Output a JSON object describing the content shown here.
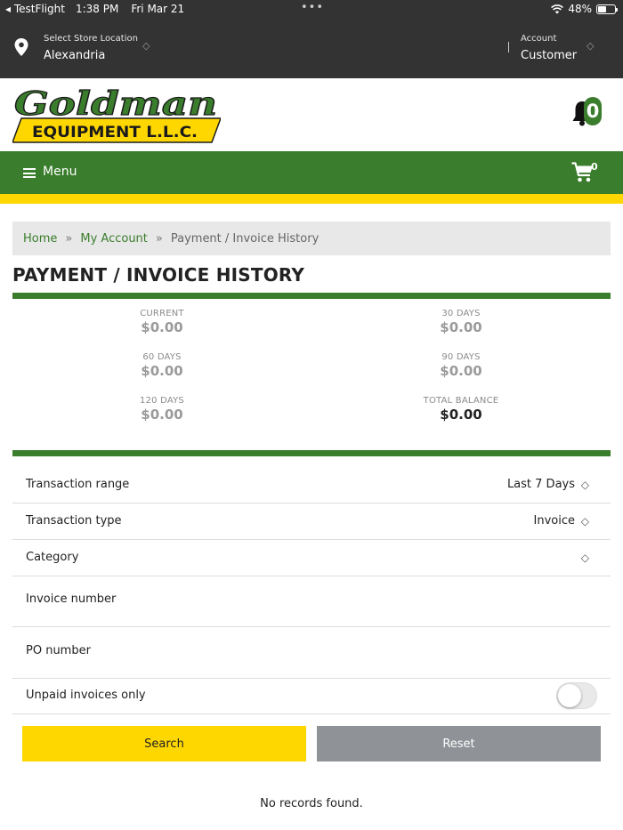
{
  "status_bar": {
    "back_app": "TestFlight",
    "time": "1:38 PM",
    "date": "Fri Mar 21",
    "dots": "•••",
    "battery": "48%",
    "battery_level": 0.48
  },
  "header": {
    "store_location_label": "Select Store Location",
    "store_location_value": "Alexandria",
    "account_label": "Account",
    "account_value": "Customer"
  },
  "brand": {
    "logo_line1": "Goldman",
    "logo_line2": "EQUIPMENT L.L.C.",
    "notification_count": "0"
  },
  "nav": {
    "menu_label": "Menu",
    "cart_count": "0"
  },
  "breadcrumb": {
    "home": "Home",
    "sep": "»",
    "my_account": "My Account",
    "current": "Payment / Invoice History"
  },
  "page": {
    "title": "PAYMENT / INVOICE HISTORY"
  },
  "summary": {
    "current_label": "CURRENT",
    "current_value": "$0.00",
    "d30_label": "30 DAYS",
    "d30_value": "$0.00",
    "d60_label": "60 DAYS",
    "d60_value": "$0.00",
    "d90_label": "90 DAYS",
    "d90_value": "$0.00",
    "d120_label": "120 DAYS",
    "d120_value": "$0.00",
    "total_label": "TOTAL BALANCE",
    "total_value": "$0.00"
  },
  "filters": {
    "transaction_range_label": "Transaction range",
    "transaction_range_value": "Last 7 Days",
    "transaction_type_label": "Transaction type",
    "transaction_type_value": "Invoice",
    "category_label": "Category",
    "category_value": "",
    "invoice_number_label": "Invoice number",
    "po_number_label": "PO number",
    "unpaid_only_label": "Unpaid invoices only"
  },
  "actions": {
    "search_label": "Search",
    "reset_label": "Reset"
  },
  "results": {
    "empty_message": "No records found."
  },
  "colors": {
    "brand_green": "#3a7d2c",
    "brand_yellow": "#ffd700",
    "header_dark": "#333333",
    "reset_gray": "#8f9297"
  }
}
